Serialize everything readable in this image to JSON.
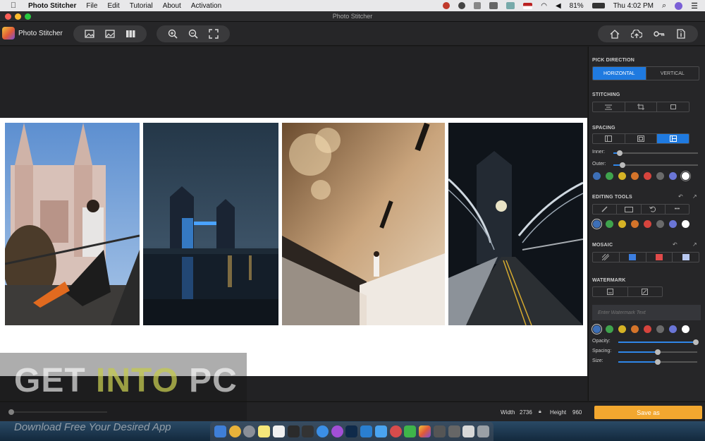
{
  "menubar": {
    "app_name": "Photo Stitcher",
    "menus": [
      "File",
      "Edit",
      "Tutorial",
      "About",
      "Activation"
    ],
    "battery": "81%",
    "clock": "Thu 4:02 PM"
  },
  "window": {
    "title": "Photo Stitcher"
  },
  "toolbar": {
    "app_label": "Photo Stitcher"
  },
  "panel": {
    "pick_direction": {
      "title": "PICK DIRECTION",
      "horizontal": "HORIZONTAL",
      "vertical": "VERTICAL",
      "selected": "horizontal"
    },
    "stitching": {
      "title": "STITCHING"
    },
    "spacing": {
      "title": "SPACING",
      "inner_label": "Inner:",
      "outer_label": "Outer:",
      "inner_level": 0.07,
      "outer_level": 0.1
    },
    "editing_tools": {
      "title": "EDITING TOOLS"
    },
    "mosaic": {
      "title": "MOSAIC"
    },
    "watermark": {
      "title": "WATERMARK",
      "placeholder": "Enter Watermark Text",
      "opacity_label": "Opacity:",
      "spacing_label": "Spacing:",
      "size_label": "Size:",
      "opacity_level": 1.0,
      "spacing_level": 0.5,
      "size_level": 0.5
    },
    "swatch_colors": [
      "#3d6fb6",
      "#3fa34d",
      "#d6b325",
      "#d4742a",
      "#d6443d",
      "#6a6a6a",
      "#6a75d6",
      "#ffffff",
      "#a8d03a"
    ]
  },
  "bottombar": {
    "width_label": "Width",
    "width_value": "2736",
    "height_label": "Height",
    "height_value": "960",
    "save_label": "Save as"
  },
  "overlay": {
    "brand_get": "GET ",
    "brand_into": "INTO",
    "brand_pc": " PC",
    "tagline": "Download Free Your Desired App"
  }
}
